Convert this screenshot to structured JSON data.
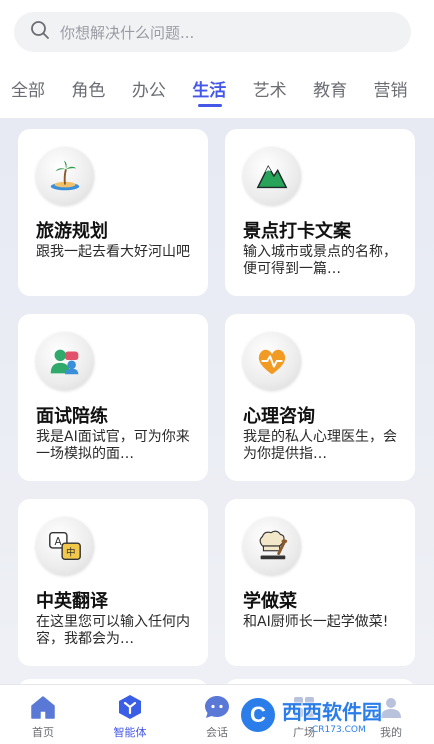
{
  "search": {
    "placeholder": "你想解决什么问题..."
  },
  "tabs": [
    {
      "label": "全部"
    },
    {
      "label": "角色"
    },
    {
      "label": "办公"
    },
    {
      "label": "生活"
    },
    {
      "label": "艺术"
    },
    {
      "label": "教育"
    },
    {
      "label": "营销"
    }
  ],
  "active_tab": "生活",
  "cards": [
    {
      "title": "旅游规划",
      "desc": "跟我一起去看大好河山吧",
      "icon": "beach-island-icon"
    },
    {
      "title": "景点打卡文案",
      "desc": "输入城市或景点的名称，便可得到一篇…",
      "icon": "mountain-icon"
    },
    {
      "title": "面试陪练",
      "desc": "我是AI面试官，可为你来一场模拟的面…",
      "icon": "interview-people-icon"
    },
    {
      "title": "心理咨询",
      "desc": "我是的私人心理医生，会为你提供指…",
      "icon": "heart-pulse-icon"
    },
    {
      "title": "中英翻译",
      "desc": "在这里您可以输入任何内容，我都会为…",
      "icon": "translate-icon"
    },
    {
      "title": "学做菜",
      "desc": "和AI厨师长一起学做菜!",
      "icon": "chef-hat-icon"
    }
  ],
  "bottom_nav": {
    "items": [
      {
        "label": "首页",
        "icon": "home-icon"
      },
      {
        "label": "智能体",
        "icon": "cube-agent-icon"
      },
      {
        "label": "会话",
        "icon": "chat-bubble-icon"
      },
      {
        "label": "广场",
        "icon": "grid-square-icon"
      },
      {
        "label": "我的",
        "icon": "profile-icon"
      }
    ]
  },
  "watermark": {
    "main": "西西软件园",
    "sub": "CR173.COM",
    "badge": "C"
  },
  "colors": {
    "accent": "#4457e6",
    "background": "#e7eaf3"
  }
}
